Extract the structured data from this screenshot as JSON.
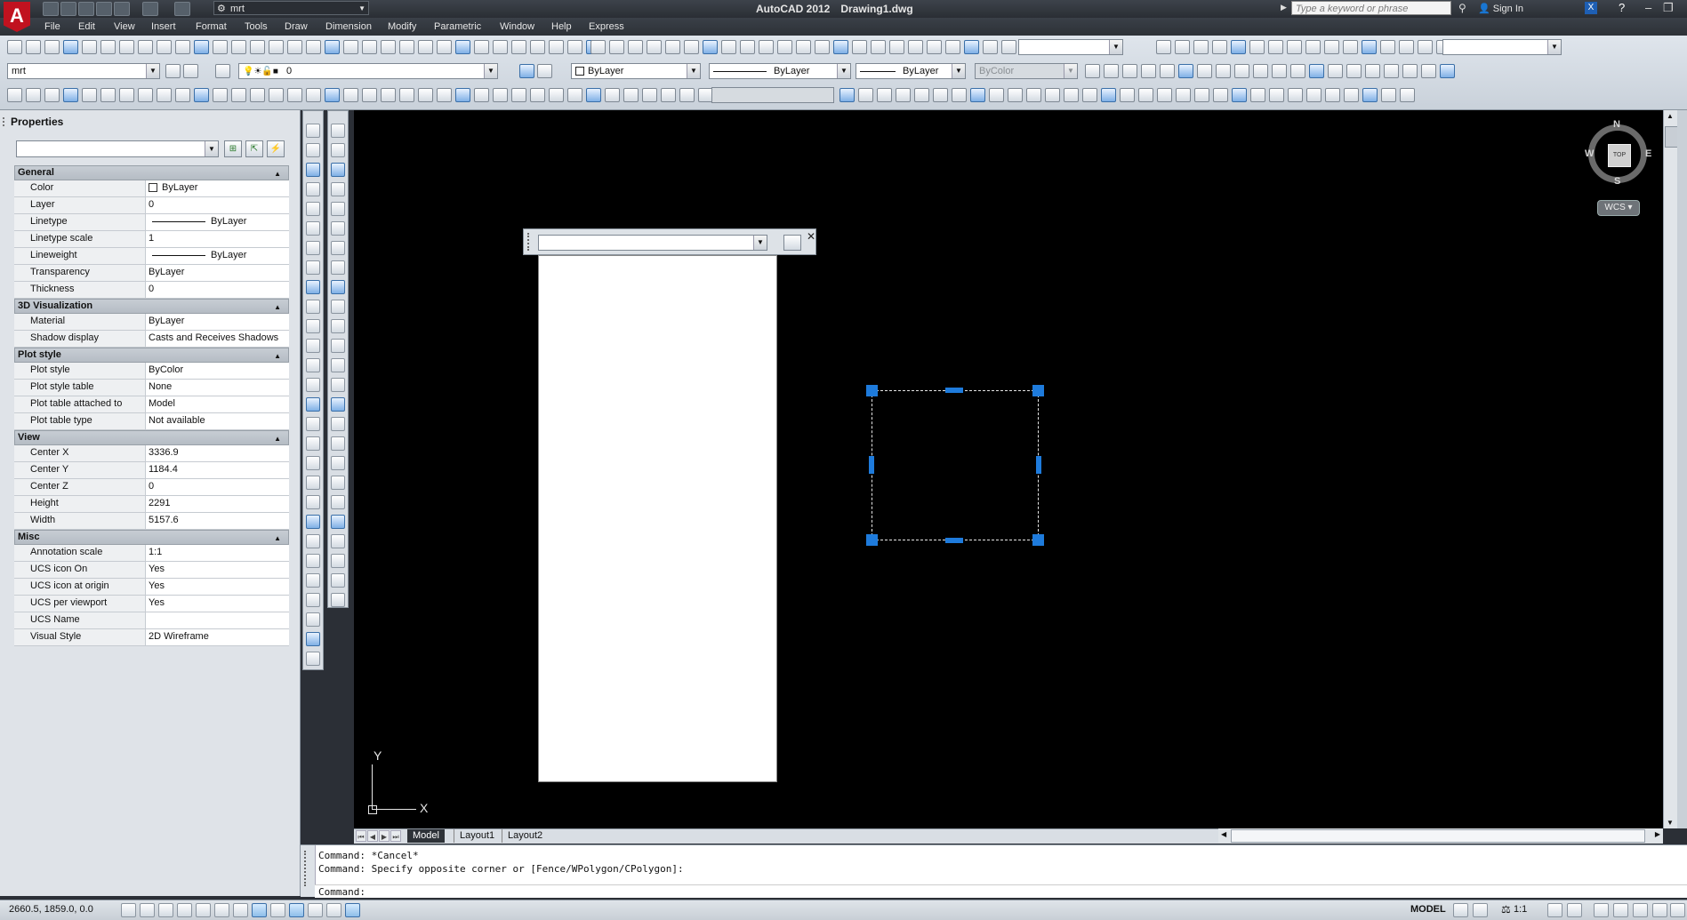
{
  "app": {
    "title": "AutoCAD 2012",
    "document": "Drawing1.dwg",
    "logo_letter": "A",
    "workspace": "mrt",
    "search_placeholder": "Type a keyword or phrase",
    "sign_in": "Sign In"
  },
  "menu": [
    "File",
    "Edit",
    "View",
    "Insert",
    "Format",
    "Tools",
    "Draw",
    "Dimension",
    "Modify",
    "Parametric",
    "Window",
    "Help",
    "Express"
  ],
  "toolbars": {
    "textstyle": "mrt",
    "layer": "0",
    "color": "ByLayer",
    "linetype": "ByLayer",
    "lineweight": "ByLayer",
    "plotstyle": "ByColor"
  },
  "properties": {
    "title": "Properties",
    "sections": [
      {
        "name": "General",
        "rows": [
          {
            "label": "Color",
            "value": "ByLayer"
          },
          {
            "label": "Layer",
            "value": "0"
          },
          {
            "label": "Linetype",
            "value": "ByLayer"
          },
          {
            "label": "Linetype scale",
            "value": "1"
          },
          {
            "label": "Lineweight",
            "value": "ByLayer"
          },
          {
            "label": "Transparency",
            "value": "ByLayer"
          },
          {
            "label": "Thickness",
            "value": "0"
          }
        ]
      },
      {
        "name": "3D Visualization",
        "rows": [
          {
            "label": "Material",
            "value": "ByLayer"
          },
          {
            "label": "Shadow display",
            "value": "Casts and Receives Shadows"
          }
        ]
      },
      {
        "name": "Plot style",
        "rows": [
          {
            "label": "Plot style",
            "value": "ByColor"
          },
          {
            "label": "Plot style table",
            "value": "None"
          },
          {
            "label": "Plot table attached to",
            "value": "Model"
          },
          {
            "label": "Plot table type",
            "value": "Not available"
          }
        ]
      },
      {
        "name": "View",
        "rows": [
          {
            "label": "Center X",
            "value": "3336.9"
          },
          {
            "label": "Center Y",
            "value": "1184.4"
          },
          {
            "label": "Center Z",
            "value": "0"
          },
          {
            "label": "Height",
            "value": "2291"
          },
          {
            "label": "Width",
            "value": "5157.6"
          }
        ]
      },
      {
        "name": "Misc",
        "rows": [
          {
            "label": "Annotation scale",
            "value": "1:1"
          },
          {
            "label": "UCS icon On",
            "value": "Yes"
          },
          {
            "label": "UCS icon at origin",
            "value": "Yes"
          },
          {
            "label": "UCS per viewport",
            "value": "Yes"
          },
          {
            "label": "UCS Name",
            "value": ""
          },
          {
            "label": "Visual Style",
            "value": "2D Wireframe"
          }
        ]
      }
    ]
  },
  "viewcube": {
    "north": "N",
    "south": "S",
    "east": "E",
    "west": "W",
    "face": "TOP",
    "wcs": "WCS"
  },
  "ucs": {
    "x": "X",
    "y": "Y"
  },
  "tabs": [
    "Model",
    "Layout1",
    "Layout2"
  ],
  "command": {
    "line1": "Command: *Cancel*",
    "line2": "Command: Specify opposite corner or [Fence/WPolygon/CPolygon]:",
    "prompt": "Command:"
  },
  "status": {
    "coords": "2660.5, 1859.0, 0.0",
    "model": "MODEL",
    "anno_scale": "1:1"
  }
}
